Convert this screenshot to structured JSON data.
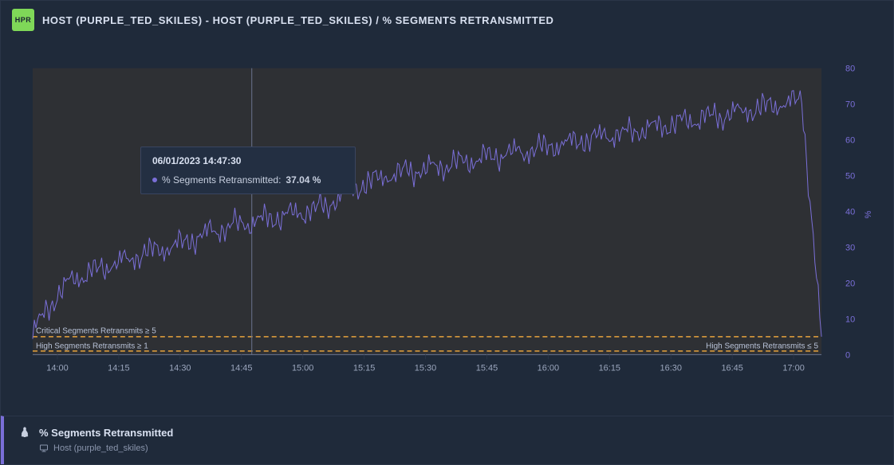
{
  "header": {
    "badge": "HPR",
    "title": "HOST (PURPLE_TED_SKILES) - HOST (PURPLE_TED_SKILES) / % SEGMENTS RETRANSMITTED"
  },
  "tooltip": {
    "timestamp": "06/01/2023 14:47:30",
    "label": "% Segments Retransmitted:",
    "value": "37.04 %"
  },
  "footer": {
    "metric": "% Segments Retransmitted",
    "host": "Host (purple_ted_skiles)"
  },
  "chart_data": {
    "type": "line",
    "title": "% Segments Retransmitted",
    "xlabel": "",
    "ylabel": "%",
    "ylim": [
      0,
      80
    ],
    "x_ticks": [
      "14:00",
      "14:15",
      "14:30",
      "14:45",
      "15:00",
      "15:15",
      "15:30",
      "15:45",
      "16:00",
      "16:15",
      "16:30",
      "16:45",
      "17:00"
    ],
    "y_ticks": [
      0,
      10,
      20,
      30,
      40,
      50,
      60,
      70,
      80
    ],
    "annotations": {
      "critical": "Critical Segments Retransmits ≥ 5",
      "high_left": "High Segments Retransmits ≥ 1",
      "high_right": "High Segments Retransmits ≤ 5"
    },
    "thresholds": [
      {
        "name": "critical",
        "value": 5
      },
      {
        "name": "high",
        "value": 1
      }
    ],
    "series": [
      {
        "name": "% Segments Retransmitted",
        "color": "#7a6fd8",
        "x": [
          "13:55",
          "14:00",
          "14:05",
          "14:10",
          "14:15",
          "14:20",
          "14:25",
          "14:30",
          "14:35",
          "14:40",
          "14:45",
          "14:50",
          "14:55",
          "15:00",
          "15:05",
          "15:10",
          "15:15",
          "15:20",
          "15:25",
          "15:30",
          "15:35",
          "15:40",
          "15:45",
          "15:50",
          "15:55",
          "16:00",
          "16:05",
          "16:10",
          "16:15",
          "16:20",
          "16:25",
          "16:30",
          "16:35",
          "16:40",
          "16:45",
          "16:50",
          "16:55",
          "17:00",
          "17:05",
          "17:08",
          "17:09"
        ],
        "values": [
          6,
          15,
          21,
          23,
          25,
          27,
          29,
          30,
          32,
          34,
          36,
          37,
          38,
          39,
          40,
          42,
          46,
          48,
          50,
          51,
          52,
          53,
          54,
          55,
          56,
          57,
          58,
          59,
          60,
          61,
          62,
          63,
          64,
          65,
          66,
          67,
          68,
          69,
          70,
          71,
          5
        ]
      }
    ]
  }
}
